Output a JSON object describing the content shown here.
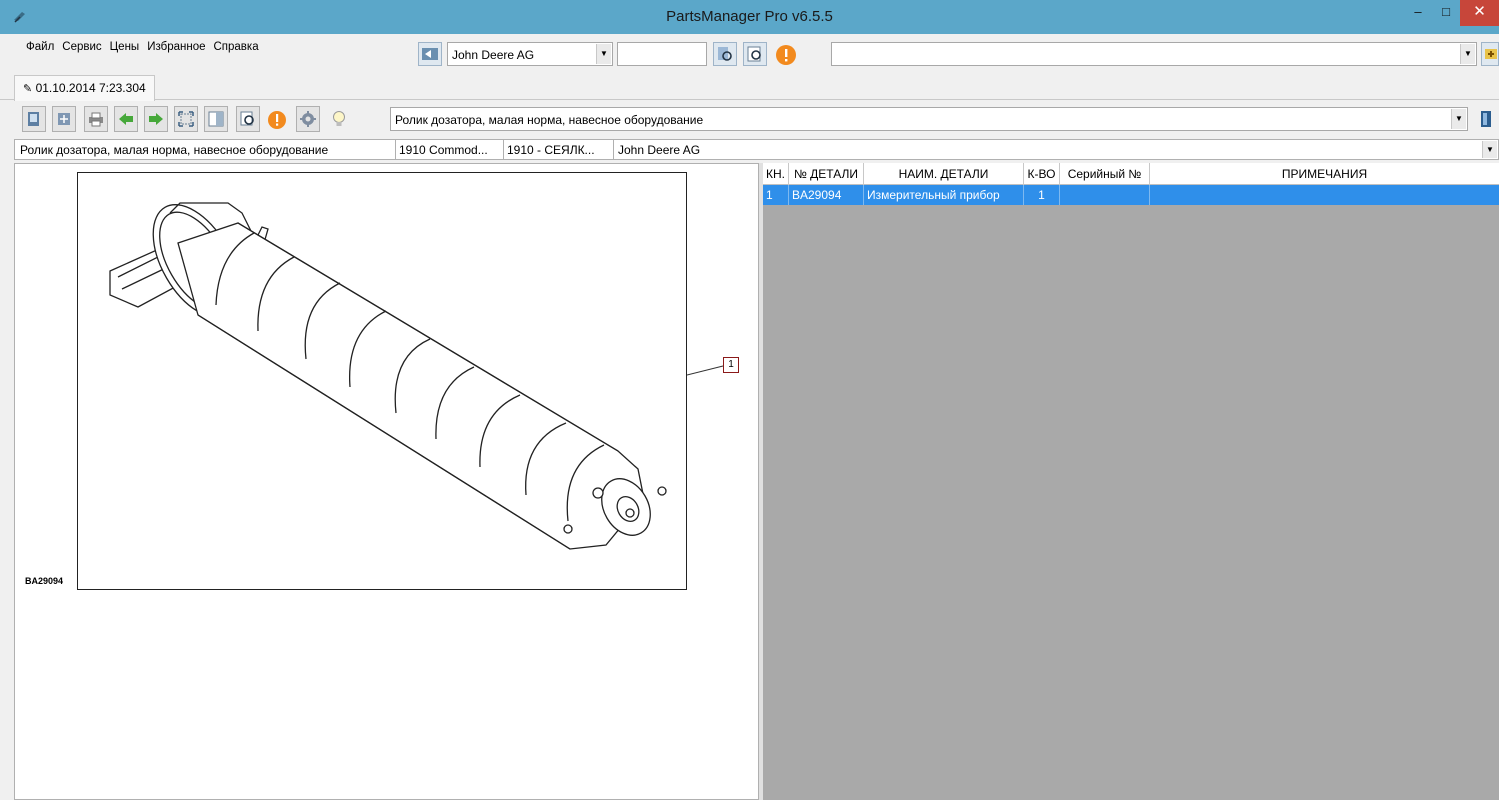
{
  "window": {
    "title": "PartsManager Pro v6.5.5",
    "min_glyph": "–",
    "max_glyph": "□",
    "close_glyph": "✕"
  },
  "menu": {
    "items": [
      {
        "label": "Файл"
      },
      {
        "label": "Сервис"
      },
      {
        "label": "Цены"
      },
      {
        "label": "Избранное"
      },
      {
        "label": "Справка"
      }
    ]
  },
  "catalog_select": {
    "value": "John Deere AG"
  },
  "search": {
    "value": ""
  },
  "top_combo": {
    "value": ""
  },
  "tab": {
    "label": "01.10.2014 7:23.304"
  },
  "part_combo": {
    "value": "Ролик дозатора, малая норма, навесное оборудование"
  },
  "breadcrumb": {
    "items": [
      "Ролик дозатора, малая норма, навесное оборудование",
      "1910 Commod...",
      "1910 - СЕЯЛК...",
      "John Deere AG"
    ]
  },
  "drawing": {
    "code": "BA29094",
    "callout": "1"
  },
  "table": {
    "headers": [
      "КН.",
      "№ ДЕТАЛИ",
      "НАИМ. ДЕТАЛИ",
      "К-ВО",
      "Серийный №",
      "ПРИМЕЧАНИЯ"
    ],
    "rows": [
      [
        "1",
        "BA29094",
        "Измерительный прибор",
        "1",
        "",
        ""
      ]
    ]
  },
  "colors": {
    "titlebar": "#5ba7c9",
    "close_button": "#c7463a",
    "selected_row": "#2f8fea",
    "grid_background": "#a9a9a9"
  }
}
